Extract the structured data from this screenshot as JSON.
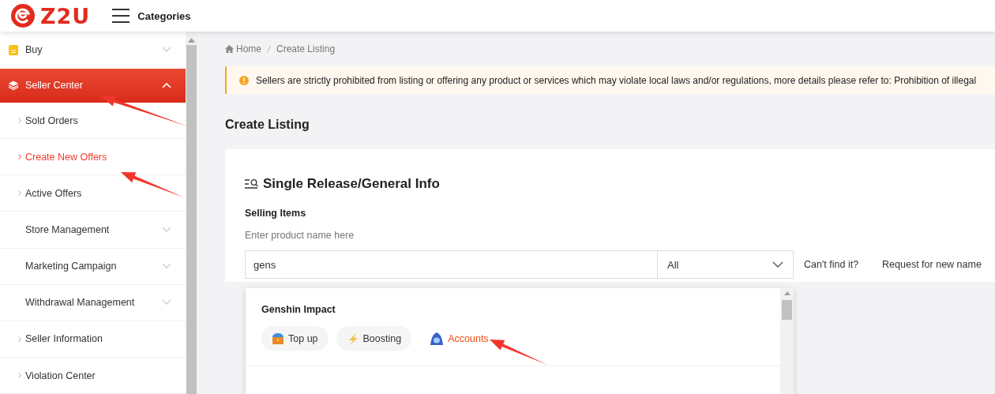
{
  "header": {
    "logo": "Z2U",
    "menu_label": "Categories"
  },
  "sidebar": {
    "items": [
      {
        "kind": "section",
        "label": "Buy",
        "expanded": false,
        "selected": false
      },
      {
        "kind": "section",
        "label": "Seller Center",
        "expanded": true,
        "selected": true
      },
      {
        "kind": "link",
        "label": "Sold Orders",
        "selected": false
      },
      {
        "kind": "link",
        "label": "Create New Offers",
        "selected": true
      },
      {
        "kind": "link",
        "label": "Active Offers",
        "selected": false
      },
      {
        "kind": "group",
        "label": "Store Management",
        "expanded": false
      },
      {
        "kind": "group",
        "label": "Marketing Campaign",
        "expanded": false
      },
      {
        "kind": "group",
        "label": "Withdrawal Management",
        "expanded": false
      },
      {
        "kind": "link",
        "label": "Seller Information",
        "selected": false
      },
      {
        "kind": "link",
        "label": "Violation Center",
        "selected": false
      }
    ]
  },
  "breadcrumb": [
    "Home",
    "Create Listing"
  ],
  "alert": {
    "text": "Sellers are strictly prohibited from listing or offering any product or services which may violate local laws and/or regulations, more details please refer to: Prohibition of illegal"
  },
  "page_title": "Create Listing",
  "card": {
    "title": "Single Release/General Info",
    "field_label": "Selling Items",
    "hint": "Enter product name here",
    "search": {
      "value": "gens"
    },
    "category_select": {
      "value": "All"
    },
    "cant_find": "Can't find it?",
    "request_link": "Request for new name",
    "suggestions": [
      {
        "game": "Genshin Impact",
        "options": [
          {
            "label": "Top up",
            "selected": false
          },
          {
            "label": "Boosting",
            "selected": false
          },
          {
            "label": "Accounts",
            "selected": true
          }
        ]
      }
    ]
  }
}
